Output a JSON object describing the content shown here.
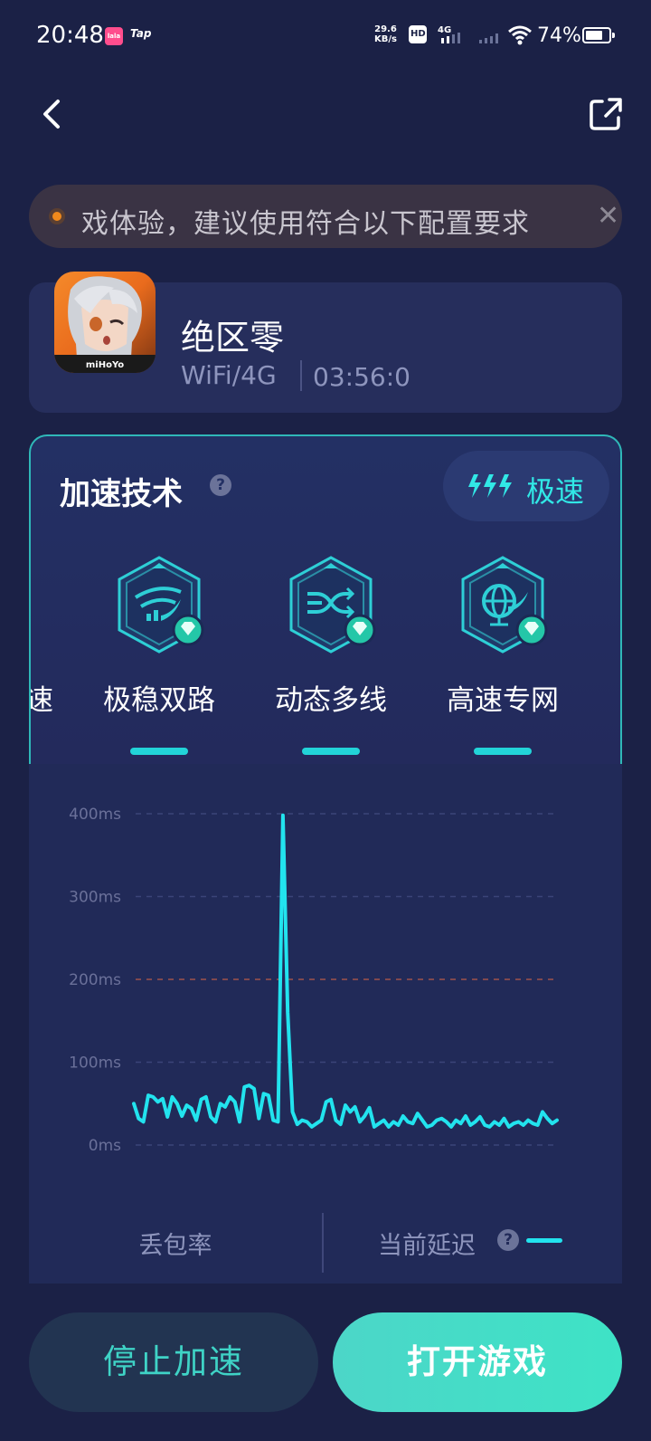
{
  "status_bar": {
    "time": "20:48",
    "app_badge_1": "lala",
    "app_badge_2": "Tap",
    "net_speed_value": "29.6",
    "net_speed_unit": "KB/s",
    "hd_label": "HD",
    "cell_label": "4G",
    "battery_text": "74%",
    "battery_level": 0.74
  },
  "notice": {
    "text": "戏体验，建议使用符合以下配置要求",
    "close_glyph": "✕"
  },
  "game": {
    "title": "绝区零",
    "network": "WiFi/4G",
    "duration": "03:56:0",
    "icon_brand": "miHoYo"
  },
  "acceleration": {
    "title": "加速技术",
    "help_glyph": "?",
    "mode_label": "极速",
    "partial_left_label": "速",
    "features": [
      {
        "label": "极稳双路",
        "icon": "wifi-boost-icon"
      },
      {
        "label": "动态多线",
        "icon": "multi-route-icon"
      },
      {
        "label": "高速专网",
        "icon": "globe-network-icon"
      }
    ]
  },
  "chart_data": {
    "type": "line",
    "ylabel": "",
    "y_ticks": [
      "400ms",
      "300ms",
      "200ms",
      "100ms",
      "0ms"
    ],
    "ylim": [
      0,
      400
    ],
    "threshold_line": 200,
    "series": [
      {
        "name": "当前延迟",
        "color": "#22e3ee",
        "values": [
          50,
          32,
          28,
          60,
          58,
          52,
          56,
          34,
          58,
          50,
          35,
          48,
          44,
          30,
          55,
          58,
          34,
          28,
          50,
          46,
          58,
          52,
          28,
          70,
          72,
          68,
          32,
          62,
          60,
          30,
          28,
          398,
          160,
          40,
          25,
          30,
          28,
          22,
          26,
          30,
          52,
          55,
          30,
          25,
          48,
          40,
          46,
          28,
          35,
          45,
          22,
          26,
          30,
          22,
          28,
          24,
          35,
          28,
          26,
          38,
          30,
          22,
          24,
          30,
          32,
          28,
          22,
          30,
          26,
          35,
          24,
          28,
          34,
          24,
          22,
          28,
          24,
          32,
          22,
          26,
          28,
          24,
          30,
          26,
          24,
          40,
          32,
          26,
          30
        ]
      }
    ]
  },
  "legend": {
    "loss_label": "丢包率",
    "latency_label": "当前延迟",
    "help_glyph": "?"
  },
  "buttons": {
    "stop_label": "停止加速",
    "open_label": "打开游戏"
  }
}
